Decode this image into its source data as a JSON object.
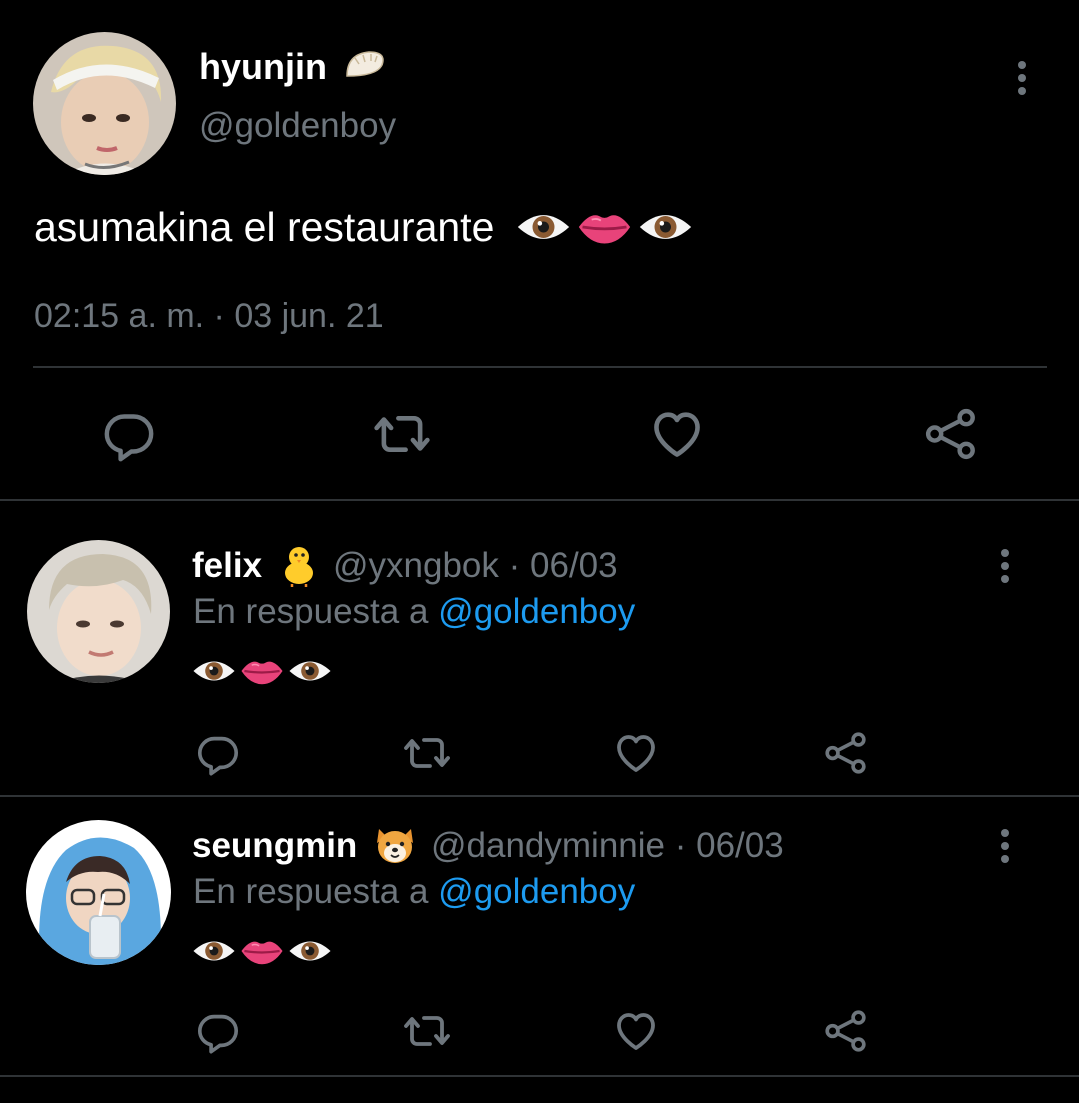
{
  "main_tweet": {
    "display_name": "hyunjin",
    "handle": "@goldenboy",
    "text": "asumakina el restaurante",
    "text_emojis": [
      "eye",
      "lips",
      "eye"
    ],
    "timestamp": "02:15 a. m. · 03 jun. 21",
    "name_emoji": "dumpling"
  },
  "replies": [
    {
      "display_name": "felix",
      "name_emoji": "chick",
      "handle": "@yxngbok",
      "date": "· 06/03",
      "reply_prefix": "En respuesta a",
      "reply_mention": "@goldenboy",
      "emojis": [
        "eye",
        "lips",
        "eye"
      ]
    },
    {
      "display_name": "seungmin",
      "name_emoji": "dog",
      "handle": "@dandyminnie",
      "date": "· 06/03",
      "reply_prefix": "En respuesta a",
      "reply_mention": "@goldenboy",
      "emojis": [
        "eye",
        "lips",
        "eye"
      ]
    }
  ],
  "icons": {
    "reply": "reply-icon",
    "retweet": "retweet-icon",
    "like": "heart-icon",
    "share": "share-icon",
    "more": "more-icon"
  },
  "colors": {
    "background": "#000000",
    "text": "#ffffff",
    "secondary": "#6e767d",
    "link": "#1d9bf0",
    "divider": "#2f3336"
  }
}
